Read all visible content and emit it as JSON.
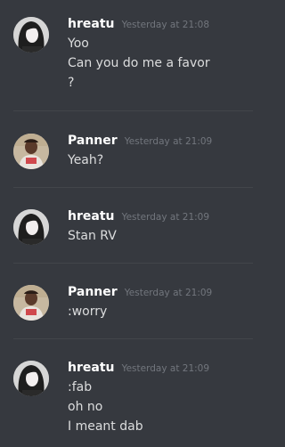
{
  "messages": [
    {
      "username": "hreatu",
      "timestamp": "Yesterday at 21:08",
      "lines": [
        "Yoo",
        "Can you do me a favor",
        "?"
      ],
      "avatar_icon": "girl-photo-avatar"
    },
    {
      "username": "Panner",
      "timestamp": "Yesterday at 21:09",
      "lines": [
        "Yeah?"
      ],
      "avatar_icon": "man-photo-avatar"
    },
    {
      "username": "hreatu",
      "timestamp": "Yesterday at 21:09",
      "lines": [
        "Stan RV"
      ],
      "avatar_icon": "girl-photo-avatar"
    },
    {
      "username": "Panner",
      "timestamp": "Yesterday at 21:09",
      "lines": [
        ":worry"
      ],
      "avatar_icon": "man-photo-avatar"
    },
    {
      "username": "hreatu",
      "timestamp": "Yesterday at 21:09",
      "lines": [
        ":fab",
        "oh no",
        "I meant dab"
      ],
      "avatar_icon": "girl-photo-avatar"
    }
  ],
  "colors": {
    "background": "#36393f",
    "username": "#ffffff",
    "timestamp": "#72767d",
    "message_text": "#dcddde",
    "divider": "#42454a"
  }
}
